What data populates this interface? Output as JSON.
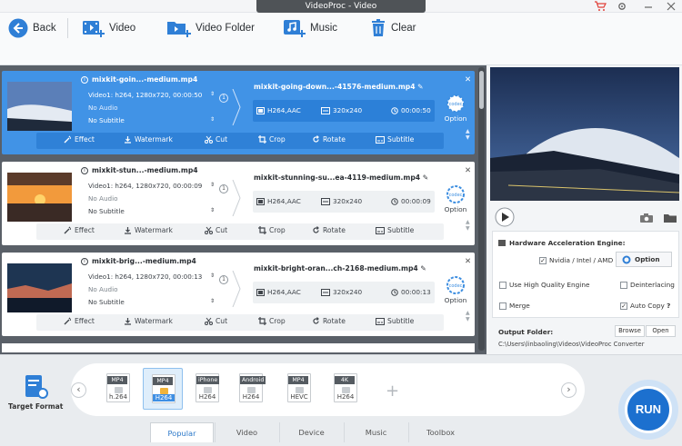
{
  "window": {
    "title": "VideoProc - Video"
  },
  "toolbar": {
    "back": "Back",
    "video": "Video",
    "video_folder": "Video Folder",
    "music": "Music",
    "clear": "Clear"
  },
  "cards": [
    {
      "source": "mixkit-goin...-medium.mp4",
      "stream": "Video1: h264, 1280x720, 00:00:50",
      "audio": "No Audio",
      "subtitle": "No Subtitle",
      "badge": "1",
      "output": "mixkit-going-down...-41576-medium.mp4",
      "codec": "H264,AAC",
      "resolution": "320x240",
      "duration": "00:00:50",
      "selected": true
    },
    {
      "source": "mixkit-stun...-medium.mp4",
      "stream": "Video1: h264, 1280x720, 00:00:09",
      "audio": "No Audio",
      "subtitle": "No Subtitle",
      "badge": "1",
      "output": "mixkit-stunning-su...ea-4119-medium.mp4",
      "codec": "H264,AAC",
      "resolution": "320x240",
      "duration": "00:00:09",
      "selected": false
    },
    {
      "source": "mixkit-brig...-medium.mp4",
      "stream": "Video1: h264, 1280x720, 00:00:13",
      "audio": "No Audio",
      "subtitle": "No Subtitle",
      "badge": "1",
      "output": "mixkit-bright-oran...ch-2168-medium.mp4",
      "codec": "H264,AAC",
      "resolution": "320x240",
      "duration": "00:00:13",
      "selected": false
    }
  ],
  "edit_actions": {
    "effect": "Effect",
    "watermark": "Watermark",
    "cut": "Cut",
    "crop": "Crop",
    "rotate": "Rotate",
    "subtitle": "Subtitle"
  },
  "option_label": "Option",
  "settings": {
    "hw_title": "Hardware Acceleration Engine:",
    "nvidia": "Nvidia / Intel / AMD",
    "option_button": "Option",
    "high_quality": "Use High Quality Engine",
    "deinterlacing": "Deinterlacing",
    "merge": "Merge",
    "auto_copy": "Auto Copy",
    "help": "?",
    "output_folder_label": "Output Folder:",
    "browse": "Browse",
    "open": "Open",
    "output_path": "C:\\Users\\linbaoling\\Videos\\VideoProc Converter"
  },
  "target_format": {
    "label": "Target Format"
  },
  "formats": [
    {
      "tag": "MP4",
      "codec": "h.264",
      "selected": false
    },
    {
      "tag": "MP4",
      "codec": "H264",
      "selected": true
    },
    {
      "tag": "iPhone",
      "codec": "H264",
      "selected": false
    },
    {
      "tag": "Android",
      "codec": "H264",
      "selected": false
    },
    {
      "tag": "MP4",
      "codec": "HEVC",
      "selected": false
    },
    {
      "tag": "4K",
      "codec": "H264",
      "selected": false
    }
  ],
  "tabs": [
    "Popular",
    "Video",
    "Device",
    "Music",
    "Toolbox"
  ],
  "run": "RUN",
  "colors": {
    "accent": "#1c70cf",
    "selected_card": "#4193e6"
  }
}
